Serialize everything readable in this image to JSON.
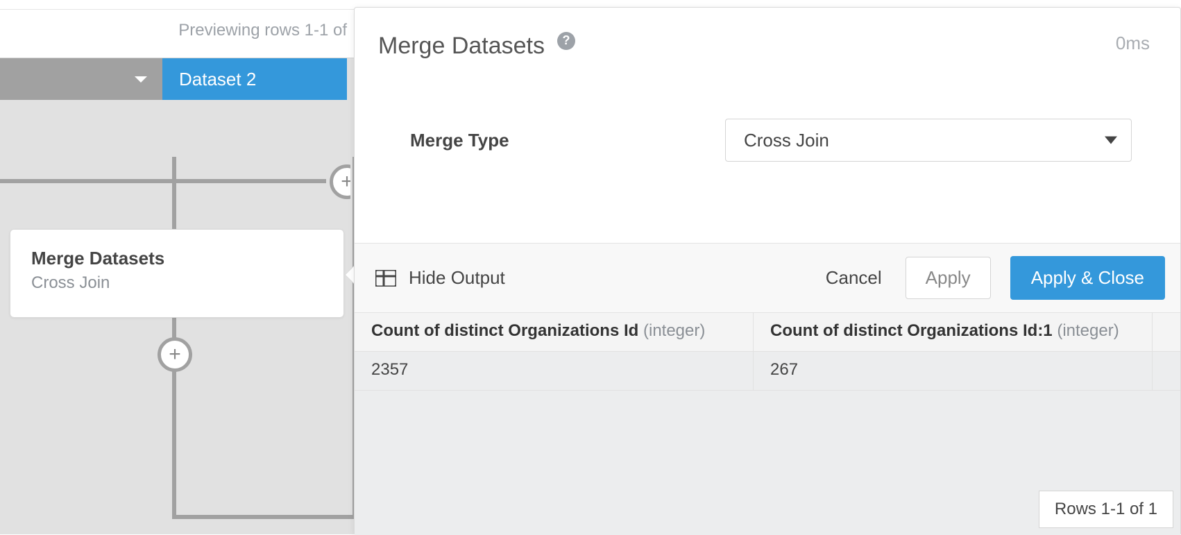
{
  "preview_text": "Previewing rows 1-1 of",
  "tabs": {
    "active_label": "Dataset 2"
  },
  "node": {
    "title": "Merge Datasets",
    "subtitle": "Cross Join"
  },
  "panel": {
    "title": "Merge Datasets",
    "elapsed": "0ms",
    "merge_type_label": "Merge Type",
    "merge_type_value": "Cross Join",
    "hide_output_label": "Hide Output",
    "cancel_label": "Cancel",
    "apply_label": "Apply",
    "apply_close_label": "Apply & Close",
    "row_counter": "Rows 1-1 of 1"
  },
  "grid": {
    "columns": [
      {
        "name": "Count of distinct Organizations Id",
        "type": "integer"
      },
      {
        "name": "Count of distinct Organizations Id:1",
        "type": "integer"
      }
    ],
    "rows": [
      {
        "c0": "2357",
        "c1": "267"
      }
    ]
  }
}
